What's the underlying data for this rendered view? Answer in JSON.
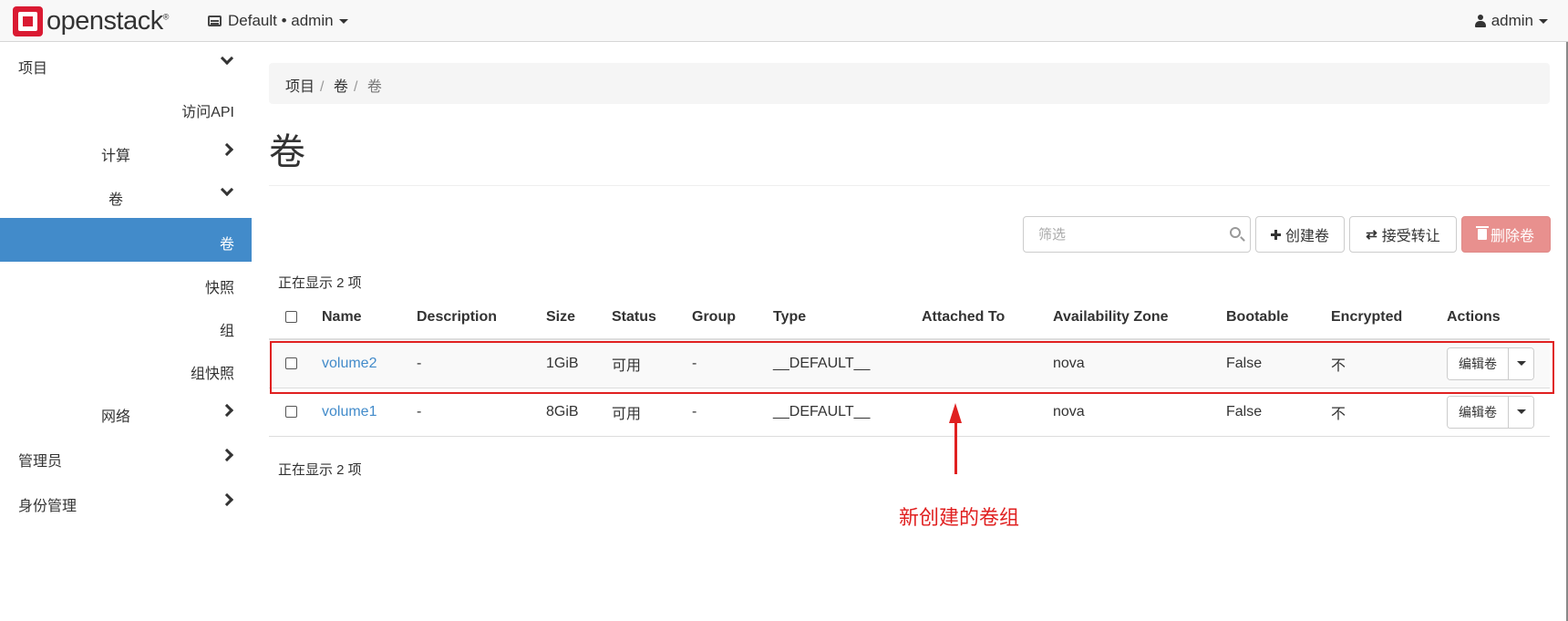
{
  "topbar": {
    "logo_text": "openstack",
    "logo_mark": "®",
    "project_selector": "Default • admin",
    "user_menu": "admin"
  },
  "sidebar": {
    "items": [
      {
        "label": "项目",
        "chevron": "down"
      },
      {
        "label": "访问API"
      },
      {
        "label": "计算",
        "chevron": "right"
      },
      {
        "label": "卷",
        "chevron": "down"
      },
      {
        "label": "卷",
        "active": true
      },
      {
        "label": "快照"
      },
      {
        "label": "组"
      },
      {
        "label": "组快照"
      },
      {
        "label": "网络",
        "chevron": "right"
      },
      {
        "label": "管理员",
        "chevron": "right"
      },
      {
        "label": "身份管理",
        "chevron": "right"
      }
    ]
  },
  "breadcrumb": [
    "项目",
    "卷",
    "卷"
  ],
  "page_title": "卷",
  "toolbar": {
    "filter_placeholder": "筛选",
    "create_label": "创建卷",
    "accept_transfer_label": "接受转让",
    "delete_label": "删除卷"
  },
  "count_text": "正在显示 2 项",
  "table": {
    "headers": [
      "Name",
      "Description",
      "Size",
      "Status",
      "Group",
      "Type",
      "Attached To",
      "Availability Zone",
      "Bootable",
      "Encrypted",
      "Actions"
    ],
    "rows": [
      {
        "name": "volume2",
        "description": "-",
        "size": "1GiB",
        "status": "可用",
        "group": "-",
        "type": "__DEFAULT__",
        "attached_to": "",
        "zone": "nova",
        "bootable": "False",
        "encrypted": "不",
        "action": "编辑卷"
      },
      {
        "name": "volume1",
        "description": "-",
        "size": "8GiB",
        "status": "可用",
        "group": "-",
        "type": "__DEFAULT__",
        "attached_to": "",
        "zone": "nova",
        "bootable": "False",
        "encrypted": "不",
        "action": "编辑卷"
      }
    ]
  },
  "annotation": {
    "text": "新创建的卷组",
    "color": "#e02020"
  },
  "colors": {
    "accent": "#428bca",
    "brand": "#da1a32",
    "danger_disabled": "#e8908e"
  }
}
